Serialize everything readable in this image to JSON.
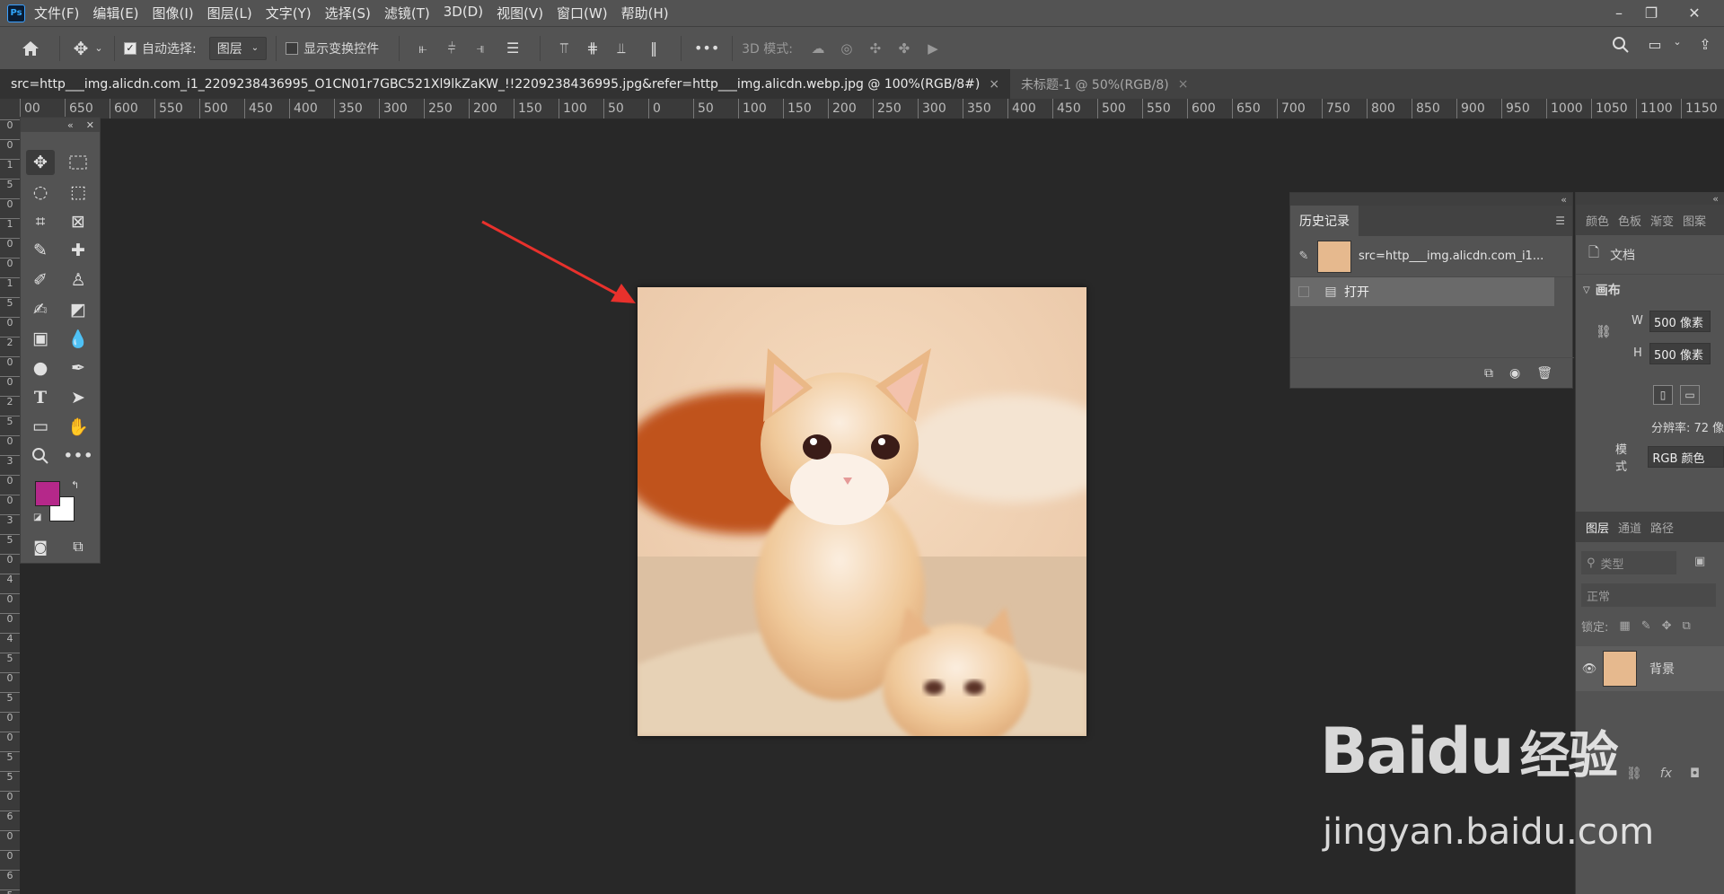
{
  "app": {
    "logo": "Ps"
  },
  "menu": [
    "文件(F)",
    "编辑(E)",
    "图像(I)",
    "图层(L)",
    "文字(Y)",
    "选择(S)",
    "滤镜(T)",
    "3D(D)",
    "视图(V)",
    "窗口(W)",
    "帮助(H)"
  ],
  "options": {
    "auto_select_label": "自动选择:",
    "auto_select_target": "图层",
    "show_transform_label": "显示变换控件",
    "mode3d_label": "3D 模式:",
    "more": "•••"
  },
  "tabs": [
    {
      "label": "src=http___img.alicdn.com_i1_2209238436995_O1CN01r7GBC521Xl9lkZaKW_!!2209238436995.jpg&refer=http___img.alicdn.webp.jpg @ 100%(RGB/8#)",
      "active": true
    },
    {
      "label": "未标题-1 @ 50%(RGB/8)",
      "active": false
    }
  ],
  "ruler_h": [
    "00",
    "650",
    "600",
    "550",
    "500",
    "450",
    "400",
    "350",
    "300",
    "250",
    "200",
    "150",
    "100",
    "50",
    "0",
    "50",
    "100",
    "150",
    "200",
    "250",
    "300",
    "350",
    "400",
    "450",
    "500",
    "550",
    "600",
    "650",
    "700",
    "750",
    "800",
    "850",
    "900",
    "950",
    "1000",
    "1050",
    "1100",
    "1150"
  ],
  "ruler_v": [
    "0",
    "0",
    "1",
    "5",
    "0",
    "1",
    "0",
    "0",
    "1",
    "5",
    "0",
    "2",
    "0",
    "0",
    "2",
    "5",
    "0",
    "3",
    "0",
    "0",
    "3",
    "5",
    "0",
    "4",
    "0",
    "0",
    "4",
    "5",
    "0",
    "5",
    "0",
    "0",
    "5",
    "5",
    "0",
    "6",
    "0",
    "0",
    "6",
    "5"
  ],
  "colors": {
    "foreground": "#b5288a",
    "background": "#ffffff",
    "arrow": "#e8312c"
  },
  "history": {
    "tab": "历史记录",
    "snapshot": "src=http___img.alicdn.com_i1...",
    "step": "打开"
  },
  "properties": {
    "tabs": [
      "颜色",
      "色板",
      "渐变",
      "图案"
    ],
    "doc_label": "文档",
    "canvas_label": "画布",
    "w_label": "W",
    "w_value": "500 像素",
    "h_label": "H",
    "h_value": "500 像素",
    "resolution": "分辨率: 72 像",
    "mode_label": "模式",
    "mode_value": "RGB 颜色"
  },
  "layers": {
    "tabs": [
      "图层",
      "通道",
      "路径"
    ],
    "search_placeholder": "类型",
    "blend": "正常",
    "lock_label": "锁定:",
    "layer_name": "背景"
  },
  "watermark": {
    "brand": "Baidu",
    "sub": "经验",
    "url": "jingyan.baidu.com"
  }
}
